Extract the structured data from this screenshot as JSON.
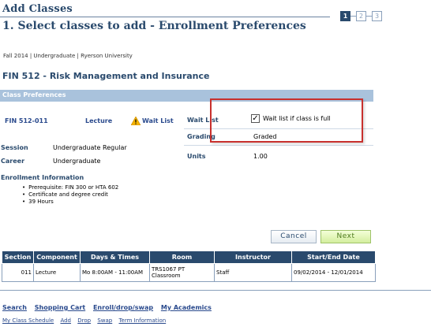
{
  "header": {
    "title": "Add Classes",
    "subtitle": "1.  Select classes to add - Enrollment Preferences",
    "steps": [
      "1",
      "2",
      "3"
    ]
  },
  "term_info": "Fall 2014 | Undergraduate | Ryerson University",
  "course_title": "FIN  512 - Risk Management and Insurance",
  "class_preferences": {
    "heading": "Class Preferences",
    "class_link": "FIN  512-011",
    "component": "Lecture",
    "status": "Wait List",
    "session_label": "Session",
    "session_value": "Undergraduate Regular",
    "career_label": "Career",
    "career_value": "Undergraduate",
    "wait_list_label": "Wait List",
    "wait_list_checkbox_label": "Wait list if class is full",
    "wait_list_checked": true,
    "grading_label": "Grading",
    "grading_value": "Graded",
    "units_label": "Units",
    "units_value": "1.00"
  },
  "enrollment_information": {
    "heading": "Enrollment Information",
    "items": [
      "Prerequisite: FIN 300 or HTA 602",
      "Certificate and degree credit",
      "39 Hours"
    ]
  },
  "buttons": {
    "cancel": "Cancel",
    "next": "Next"
  },
  "class_table": {
    "headers": [
      "Section",
      "Component",
      "Days & Times",
      "Room",
      "Instructor",
      "Start/End Date"
    ],
    "rows": [
      {
        "section": "011",
        "component": "Lecture",
        "days_times": "Mo 8:00AM - 11:00AM",
        "room": "TRS1067 PT Classroom",
        "instructor": "Staff",
        "dates": "09/02/2014 - 12/01/2014"
      }
    ]
  },
  "nav_primary": [
    "Search",
    "Shopping Cart",
    "Enroll/drop/swap",
    "My Academics"
  ],
  "nav_secondary": [
    "My Class Schedule",
    "Add",
    "Drop",
    "Swap",
    "Term Information"
  ],
  "colors": {
    "heading_blue": "#2a4a6d",
    "section_bar": "#a9c2dc",
    "highlight_red": "#c8302d",
    "next_green": "#d4ee9e",
    "warning_yellow": "#f5b301"
  }
}
